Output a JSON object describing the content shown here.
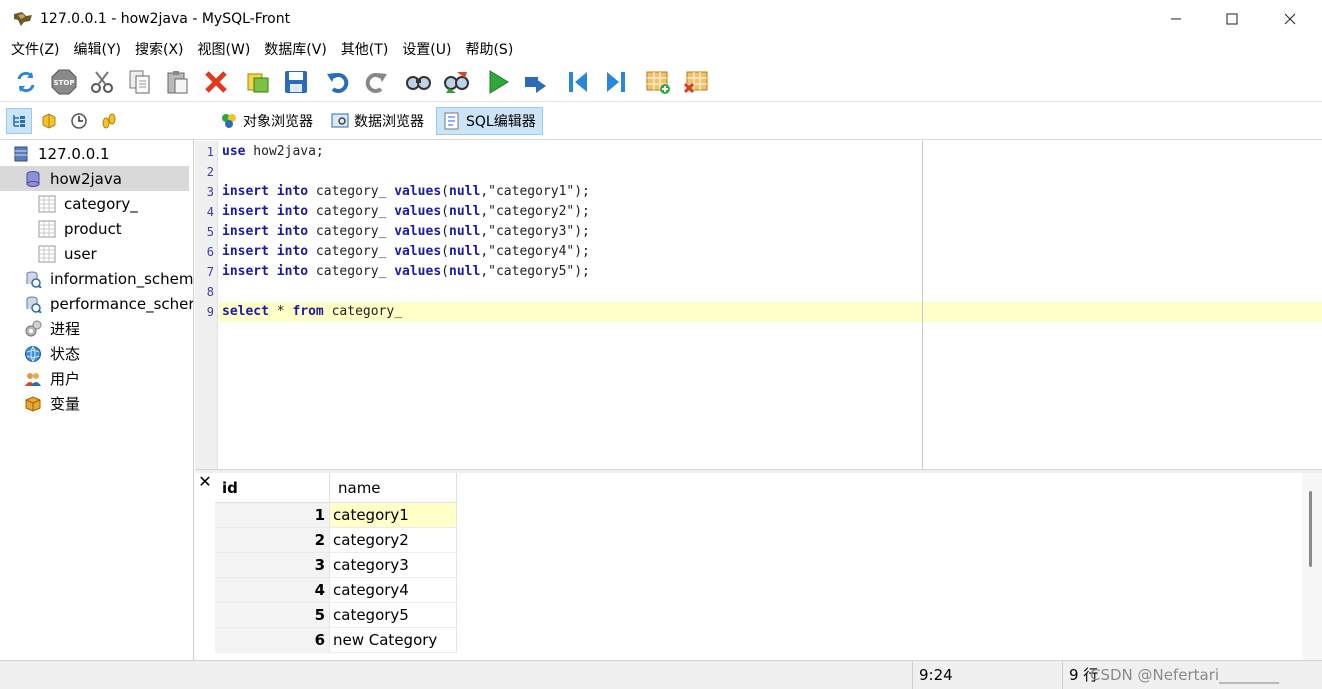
{
  "window": {
    "title": "127.0.0.1 - how2java - MySQL-Front",
    "minimize": "—",
    "maximize": "☐",
    "close": "✕"
  },
  "menu": [
    "文件(Z)",
    "编辑(Y)",
    "搜索(X)",
    "视图(W)",
    "数据库(V)",
    "其他(T)",
    "设置(U)",
    "帮助(S)"
  ],
  "toolbar": {
    "icons": [
      "refresh-icon",
      "stop-icon",
      "cut-icon",
      "copy-icon",
      "paste-icon",
      "delete-icon",
      "properties-icon",
      "save-icon",
      "undo-icon",
      "redo-icon",
      "find-icon",
      "replace-icon",
      "run-icon",
      "run-selection-icon",
      "first-record-icon",
      "last-record-icon",
      "insert-record-icon",
      "delete-record-icon"
    ]
  },
  "view_tabs": [
    {
      "label": "对象浏览器",
      "icon": "object-browser-icon",
      "active": false
    },
    {
      "label": "数据浏览器",
      "icon": "data-browser-icon",
      "active": false
    },
    {
      "label": "SQL编辑器",
      "icon": "sql-editor-icon",
      "active": true
    }
  ],
  "tree": [
    {
      "label": "127.0.0.1",
      "icon": "server-icon",
      "level": 0,
      "selected": false
    },
    {
      "label": "how2java",
      "icon": "database-icon",
      "level": 1,
      "selected": true
    },
    {
      "label": "category_",
      "icon": "table-icon",
      "level": 2,
      "selected": false
    },
    {
      "label": "product",
      "icon": "table-icon",
      "level": 2,
      "selected": false
    },
    {
      "label": "user",
      "icon": "table-icon",
      "level": 2,
      "selected": false
    },
    {
      "label": "information_schem",
      "icon": "system-database-icon",
      "level": 1,
      "selected": false
    },
    {
      "label": "performance_scher",
      "icon": "system-database-icon",
      "level": 1,
      "selected": false
    },
    {
      "label": "进程",
      "icon": "processes-icon",
      "level": 1,
      "selected": false
    },
    {
      "label": "状态",
      "icon": "status-icon",
      "level": 1,
      "selected": false
    },
    {
      "label": "用户",
      "icon": "users-icon",
      "level": 1,
      "selected": false
    },
    {
      "label": "变量",
      "icon": "variables-icon",
      "level": 1,
      "selected": false
    }
  ],
  "editor": {
    "line_numbers": [
      "1",
      "2",
      "3",
      "4",
      "5",
      "6",
      "7",
      "8",
      "9"
    ],
    "lines": [
      [
        {
          "t": "use",
          "k": true
        },
        {
          "t": " how2java;",
          "k": false
        }
      ],
      [],
      [
        {
          "t": "insert",
          "k": true
        },
        {
          "t": " ",
          "k": false
        },
        {
          "t": "into",
          "k": true
        },
        {
          "t": " category_ ",
          "k": false
        },
        {
          "t": "values",
          "k": true
        },
        {
          "t": "(",
          "k": false
        },
        {
          "t": "null",
          "k": true
        },
        {
          "t": ",\"category1\");",
          "k": false
        }
      ],
      [
        {
          "t": "insert",
          "k": true
        },
        {
          "t": " ",
          "k": false
        },
        {
          "t": "into",
          "k": true
        },
        {
          "t": " category_ ",
          "k": false
        },
        {
          "t": "values",
          "k": true
        },
        {
          "t": "(",
          "k": false
        },
        {
          "t": "null",
          "k": true
        },
        {
          "t": ",\"category2\");",
          "k": false
        }
      ],
      [
        {
          "t": "insert",
          "k": true
        },
        {
          "t": " ",
          "k": false
        },
        {
          "t": "into",
          "k": true
        },
        {
          "t": " category_ ",
          "k": false
        },
        {
          "t": "values",
          "k": true
        },
        {
          "t": "(",
          "k": false
        },
        {
          "t": "null",
          "k": true
        },
        {
          "t": ",\"category3\");",
          "k": false
        }
      ],
      [
        {
          "t": "insert",
          "k": true
        },
        {
          "t": " ",
          "k": false
        },
        {
          "t": "into",
          "k": true
        },
        {
          "t": " category_ ",
          "k": false
        },
        {
          "t": "values",
          "k": true
        },
        {
          "t": "(",
          "k": false
        },
        {
          "t": "null",
          "k": true
        },
        {
          "t": ",\"category4\");",
          "k": false
        }
      ],
      [
        {
          "t": "insert",
          "k": true
        },
        {
          "t": " ",
          "k": false
        },
        {
          "t": "into",
          "k": true
        },
        {
          "t": " category_ ",
          "k": false
        },
        {
          "t": "values",
          "k": true
        },
        {
          "t": "(",
          "k": false
        },
        {
          "t": "null",
          "k": true
        },
        {
          "t": ",\"category5\");",
          "k": false
        }
      ],
      [],
      [
        {
          "t": "select",
          "k": true
        },
        {
          "t": " * ",
          "k": false
        },
        {
          "t": "from",
          "k": true
        },
        {
          "t": " category_",
          "k": false
        }
      ]
    ],
    "current_line": 9,
    "highlight_color": "#ffffc8",
    "keyword_color": "#1a1aa6"
  },
  "result": {
    "close": "✕",
    "columns": [
      "id",
      "name"
    ],
    "rows": [
      {
        "id": "1",
        "name": "category1"
      },
      {
        "id": "2",
        "name": "category2"
      },
      {
        "id": "3",
        "name": "category3"
      },
      {
        "id": "4",
        "name": "category4"
      },
      {
        "id": "5",
        "name": "category5"
      },
      {
        "id": "6",
        "name": "new Category"
      }
    ],
    "selected_row": 1,
    "selected_color": "#ffffc8"
  },
  "status": {
    "cursor": "9:24",
    "rows": "9 行",
    "watermark": "CSDN @Nefertari________"
  }
}
